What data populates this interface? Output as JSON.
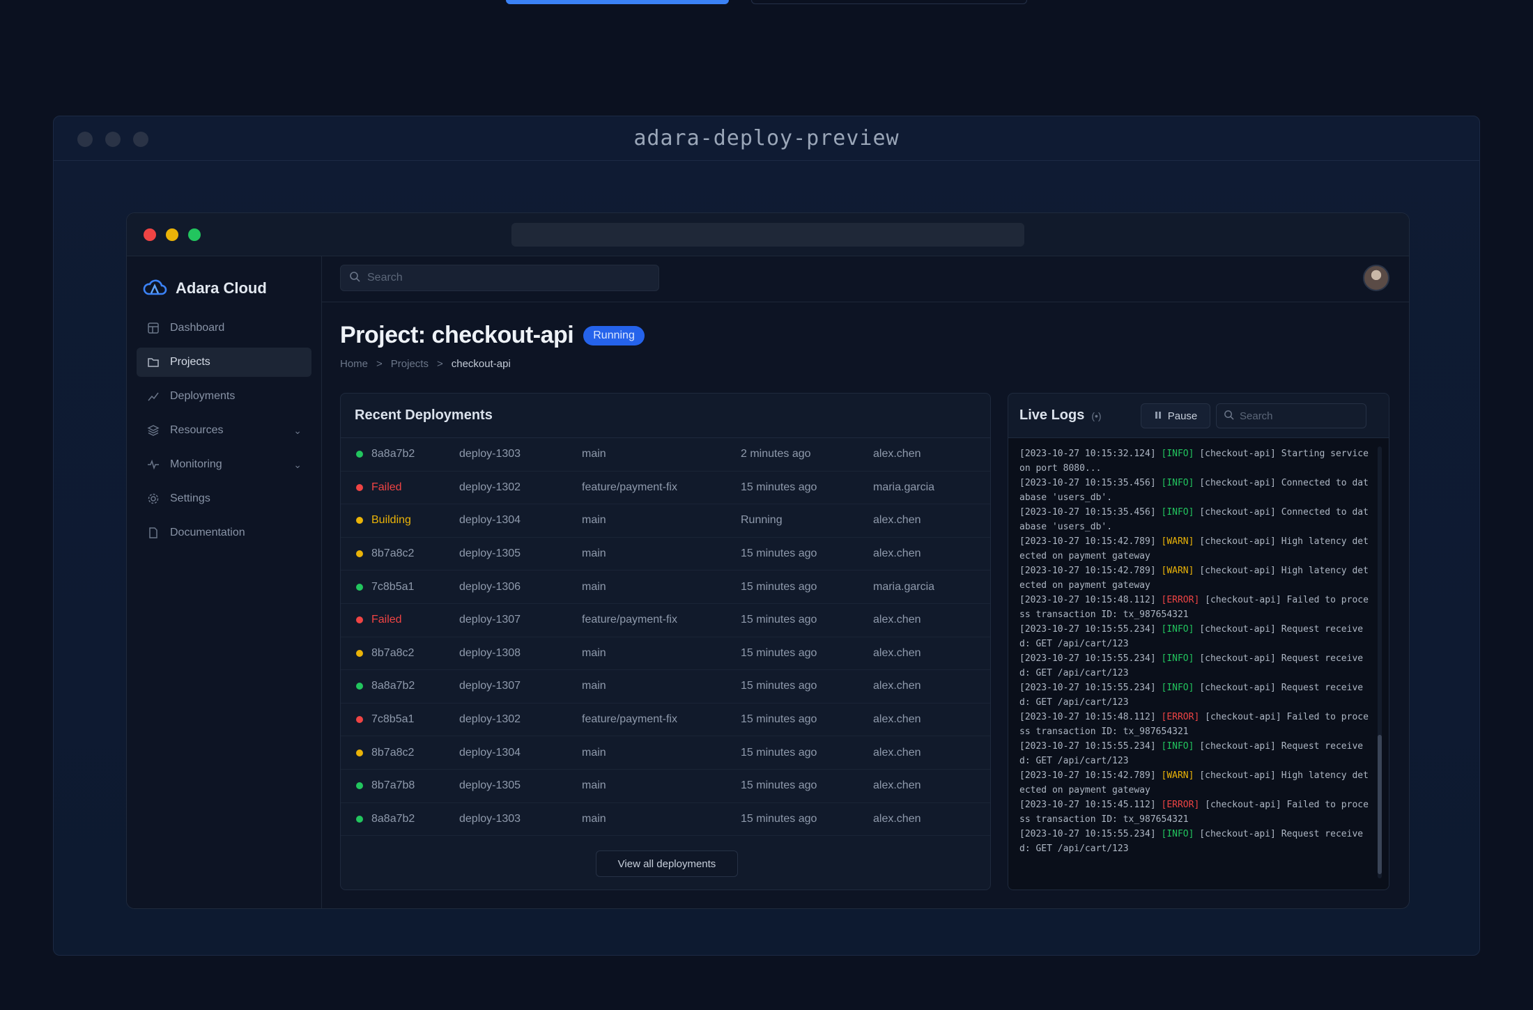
{
  "outer_window": {
    "title": "adara-deploy-preview"
  },
  "app": {
    "brand": "Adara Cloud",
    "search_placeholder": "Search",
    "sidebar": {
      "items": [
        {
          "label": "Dashboard",
          "icon": "dashboard-icon"
        },
        {
          "label": "Projects",
          "icon": "folder-icon",
          "active": true
        },
        {
          "label": "Deployments",
          "icon": "deployments-icon"
        },
        {
          "label": "Resources",
          "icon": "resources-icon",
          "expandable": true
        },
        {
          "label": "Monitoring",
          "icon": "monitoring-icon",
          "expandable": true
        },
        {
          "label": "Settings",
          "icon": "gear-icon"
        },
        {
          "label": "Documentation",
          "icon": "document-icon"
        }
      ]
    },
    "page": {
      "title": "Project: checkout-api",
      "status_badge": "Running",
      "breadcrumb": [
        "Home",
        "Projects",
        "checkout-api"
      ],
      "breadcrumb_separator": ">"
    },
    "deployments": {
      "title": "Recent Deployments",
      "rows": [
        {
          "status": "success",
          "commit": "8a8a7b2",
          "id": "deploy-1303",
          "branch": "main",
          "time": "2 minutes ago",
          "author": "alex.chen"
        },
        {
          "status": "failed",
          "commit": "Failed",
          "id": "deploy-1302",
          "branch": "feature/payment-fix",
          "time": "15 minutes ago",
          "author": "maria.garcia"
        },
        {
          "status": "building",
          "commit": "Building",
          "id": "deploy-1304",
          "branch": "main",
          "time": "Running",
          "author": "alex.chen"
        },
        {
          "status": "building",
          "commit": "8b7a8c2",
          "id": "deploy-1305",
          "branch": "main",
          "time": "15 minutes ago",
          "author": "alex.chen"
        },
        {
          "status": "success",
          "commit": "7c8b5a1",
          "id": "deploy-1306",
          "branch": "main",
          "time": "15 minutes ago",
          "author": "maria.garcia"
        },
        {
          "status": "failed",
          "commit": "Failed",
          "id": "deploy-1307",
          "branch": "feature/payment-fix",
          "time": "15 minutes ago",
          "author": "alex.chen"
        },
        {
          "status": "building",
          "commit": "8b7a8c2",
          "id": "deploy-1308",
          "branch": "main",
          "time": "15 minutes ago",
          "author": "alex.chen"
        },
        {
          "status": "success",
          "commit": "8a8a7b2",
          "id": "deploy-1307",
          "branch": "main",
          "time": "15 minutes ago",
          "author": "alex.chen"
        },
        {
          "status": "failed",
          "commit": "7c8b5a1",
          "id": "deploy-1302",
          "branch": "feature/payment-fix",
          "time": "15 minutes ago",
          "author": "alex.chen"
        },
        {
          "status": "building",
          "commit": "8b7a8c2",
          "id": "deploy-1304",
          "branch": "main",
          "time": "15 minutes ago",
          "author": "alex.chen"
        },
        {
          "status": "success",
          "commit": "8b7a7b8",
          "id": "deploy-1305",
          "branch": "main",
          "time": "15 minutes ago",
          "author": "alex.chen"
        },
        {
          "status": "success",
          "commit": "8a8a7b2",
          "id": "deploy-1303",
          "branch": "main",
          "time": "15 minutes ago",
          "author": "alex.chen"
        }
      ],
      "view_all": "View all deployments"
    },
    "logs": {
      "title": "Live Logs",
      "live_indicator": "(•)",
      "pause_label": "Pause",
      "search_placeholder": "Search",
      "lines": [
        {
          "ts": "[2023-10-27 10:15:32.124]",
          "level": "[INFO]",
          "lv": "info",
          "msg": "[checkout-api] Starting service on port 8080..."
        },
        {
          "ts": "[2023-10-27 10:15:35.456]",
          "level": "[INFO]",
          "lv": "info",
          "msg": "[checkout-api] Connected to database 'users_db'."
        },
        {
          "ts": "[2023-10-27 10:15:35.456]",
          "level": "[INFO]",
          "lv": "info",
          "msg": "[checkout-api] Connected to database 'users_db'."
        },
        {
          "ts": "[2023-10-27 10:15:42.789]",
          "level": "[WARN]",
          "lv": "warn",
          "msg": "[checkout-api] High latency detected on payment gateway"
        },
        {
          "ts": "[2023-10-27 10:15:42.789]",
          "level": "[WARN]",
          "lv": "warn",
          "msg": "[checkout-api] High latency detected on payment gateway"
        },
        {
          "ts": "[2023-10-27 10:15:48.112]",
          "level": "[ERROR]",
          "lv": "error",
          "msg": "[checkout-api] Failed to process transaction ID: tx_987654321"
        },
        {
          "ts": "[2023-10-27 10:15:55.234]",
          "level": "[INFO]",
          "lv": "info",
          "msg": "[checkout-api] Request received: GET /api/cart/123"
        },
        {
          "ts": "[2023-10-27 10:15:55.234]",
          "level": "[INFO]",
          "lv": "info",
          "msg": "[checkout-api] Request received: GET /api/cart/123"
        },
        {
          "ts": "[2023-10-27 10:15:55.234]",
          "level": "[INFO]",
          "lv": "info",
          "msg": "[checkout-api] Request received: GET /api/cart/123"
        },
        {
          "ts": "[2023-10-27 10:15:48.112]",
          "level": "[ERROR]",
          "lv": "error",
          "msg": "[checkout-api] Failed to process transaction ID: tx_987654321"
        },
        {
          "ts": "[2023-10-27 10:15:55.234]",
          "level": "[INFO]",
          "lv": "info",
          "msg": "[checkout-api] Request received: GET /api/cart/123"
        },
        {
          "ts": "[2023-10-27 10:15:42.789]",
          "level": "[WARN]",
          "lv": "warn",
          "msg": "[checkout-api] High latency detected on payment gateway"
        },
        {
          "ts": "[2023-10-27 10:15:45.112]",
          "level": "[ERROR]",
          "lv": "error",
          "msg": "[checkout-api] Failed to process transaction ID: tx_987654321"
        },
        {
          "ts": "[2023-10-27 10:15:55.234]",
          "level": "[INFO]",
          "lv": "info",
          "msg": "[checkout-api] Request received: GET /api/cart/123"
        }
      ]
    }
  },
  "colors": {
    "success": "#22c55e",
    "failed": "#ef4444",
    "building": "#eab308",
    "accent": "#2563eb"
  }
}
